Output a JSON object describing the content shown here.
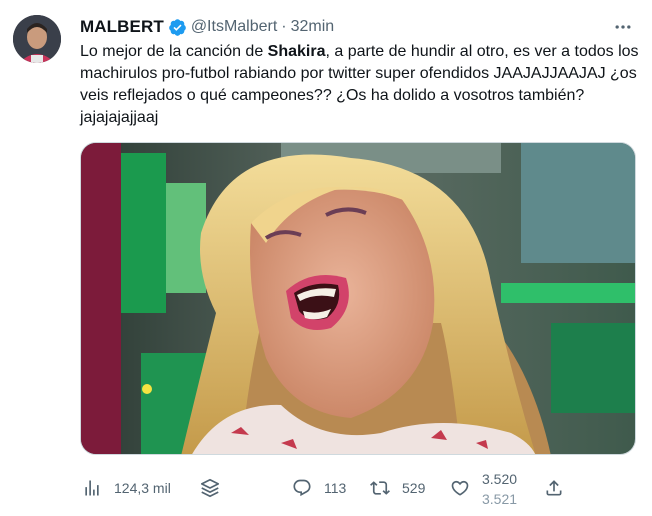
{
  "author": {
    "name": "MALBERT",
    "handle": "@ItsMalbert",
    "separator": "·",
    "time": "32min"
  },
  "tweet": {
    "text_part1": "Lo mejor de la canción de ",
    "text_bold": "Shakira",
    "text_part2": ", a parte de hundir al otro, es ver a todos los machirulos pro-futbol rabiando por twitter super ofendidos JAAJAJJAAJAJ ¿os veis reflejados o qué campeones?? ¿Os ha dolido a vosotros también? jajajajajjaaj"
  },
  "actions": {
    "views": "124,3 mil",
    "replies": "113",
    "retweets": "529",
    "likes": "3.520",
    "likes_next": "3.521"
  },
  "colors": {
    "text": "#0f1419",
    "secondary": "#536471",
    "verified": "#1d9bf0"
  },
  "icons": [
    "verified-badge-icon",
    "more-icon",
    "views-icon",
    "stack-icon",
    "reply-icon",
    "retweet-icon",
    "like-icon",
    "share-icon"
  ]
}
